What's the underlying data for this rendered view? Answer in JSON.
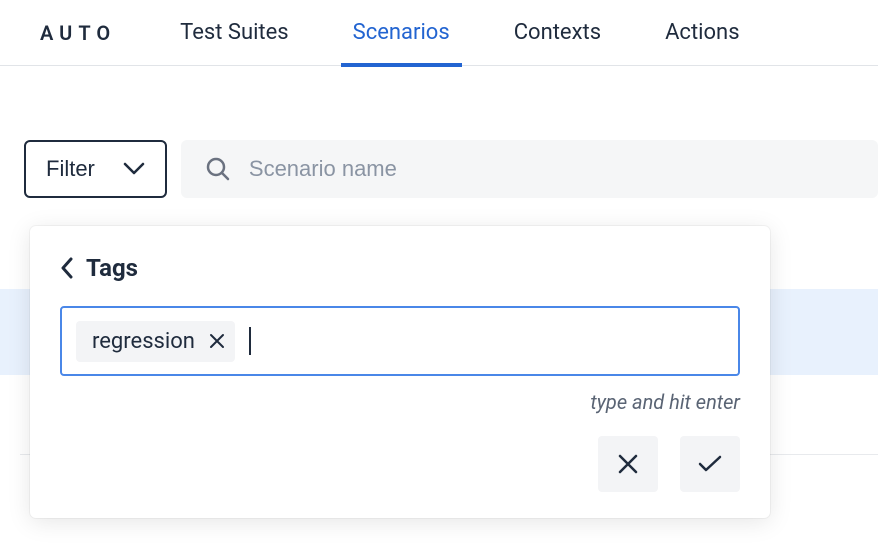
{
  "brand": "AUTO",
  "tabs": {
    "suites": "Test Suites",
    "scenarios": "Scenarios",
    "contexts": "Contexts",
    "actions": "Actions"
  },
  "filter": {
    "label": "Filter"
  },
  "search": {
    "placeholder": "Scenario name"
  },
  "popover": {
    "title": "Tags",
    "tags": [
      {
        "label": "regression"
      }
    ],
    "hint": "type and hit enter"
  }
}
